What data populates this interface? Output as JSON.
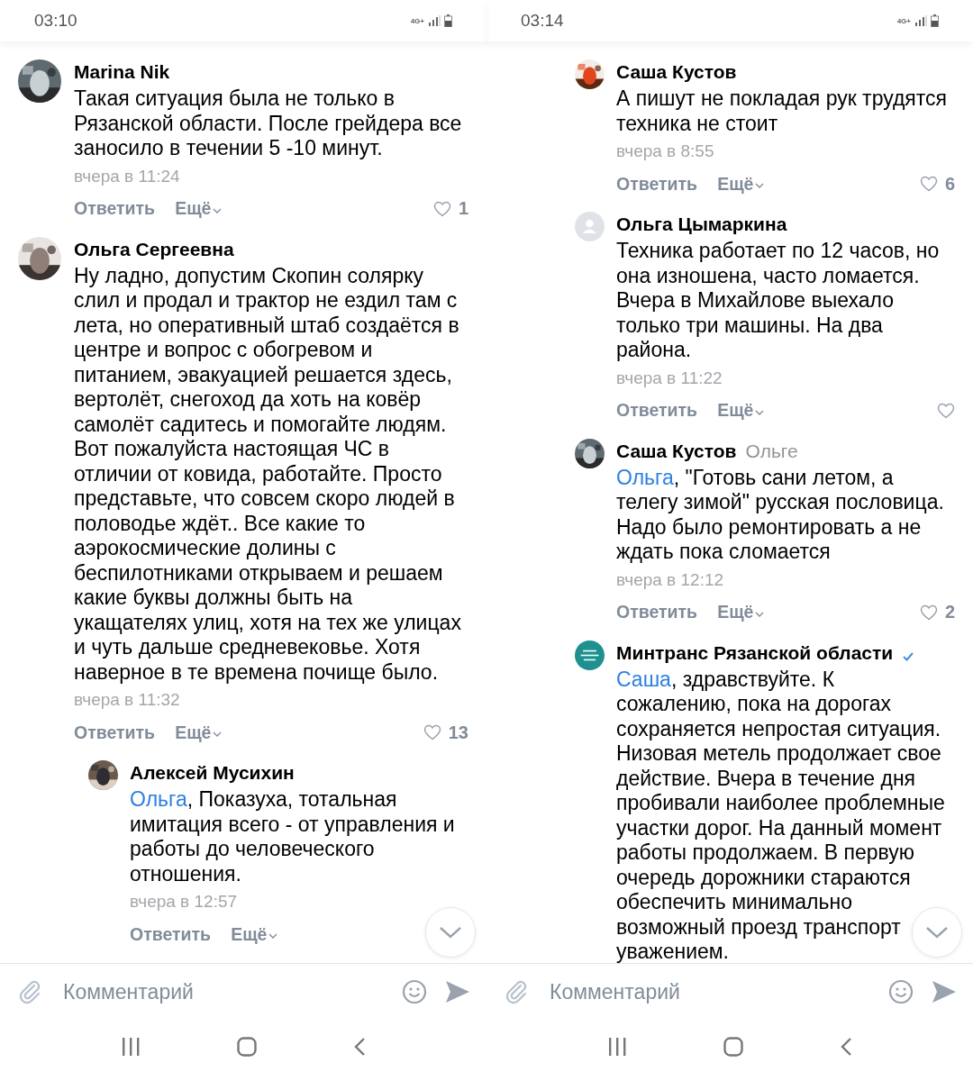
{
  "panels": [
    {
      "status_bar": {
        "time": "03:10",
        "network": "4G+"
      },
      "comments": [
        {
          "author": "Marina Nik",
          "body": "Такая ситуация была не только в Рязанской области. После грейдера все заносило в течении 5 -10 минут.",
          "time": "вчера в 11:24",
          "reply": "Ответить",
          "more": "Ещё",
          "like_button": true,
          "likes": "1"
        },
        {
          "author": "Ольга Сергеевна",
          "body": "Ну ладно, допустим Скопин солярку слил и продал и трактор не ездил там с лета, но оперативный штаб создаётся в центре и вопрос с обогревом и питанием, эвакуацией решается здесь, вертолёт, снегоход да хоть на ковёр самолёт садитесь и помогайте людям. Вот пожалуйста настоящая ЧС в отличии от ковида, работайте. Просто представьте, что совсем скоро людей в половодье ждёт.. Все какие то аэрокосмические долины с беспилотниками открываем и решаем какие буквы должны быть на укащателях улиц, хотя на тех же улицах и чуть дальше средневековье. Хотя наверное в те времена почище было.",
          "time": "вчера в 11:32",
          "reply": "Ответить",
          "more": "Ещё",
          "like_button": true,
          "likes": "13",
          "children": [
            {
              "author": "Алексей Мусихин",
              "mention": "Ольга",
              "body": ", Показуха, тотальная имитация всего - от управления и работы до человеческого отношения.",
              "time": "вчера в 12:57",
              "reply": "Ответить",
              "more": "Ещё"
            }
          ]
        }
      ],
      "composer": {
        "placeholder": "Комментарий"
      }
    },
    {
      "status_bar": {
        "time": "03:14",
        "network": "4G+"
      },
      "replies": [
        {
          "author": "Саша Кустов",
          "body": "А пишут не покладая рук трудятся техника не стоит",
          "time": "вчера в 8:55",
          "reply": "Ответить",
          "more": "Ещё",
          "like_button": true,
          "likes": "6"
        },
        {
          "author": "Ольга Цымаркина",
          "kind": "default",
          "body": "Техника работает по 12 часов, но она изношена, часто ломается. Вчера в Михайлове выехало только три машины. На два района.",
          "time": "вчера в 11:22",
          "reply": "Ответить",
          "more": "Ещё",
          "like_button": true
        },
        {
          "author": "Саша Кустов",
          "reply_to": "Ольге",
          "mention": "Ольга",
          "body": ", \"Готовь сани летом, а телегу зимой\" русская пословица. Надо было ремонтировать а не ждать пока сломается",
          "time": "вчера в 12:12",
          "reply": "Ответить",
          "more": "Ещё",
          "like_button": true,
          "likes": "2"
        },
        {
          "author": "Минтранс Рязанской области",
          "kind": "logo",
          "verified": true,
          "mention": "Саша",
          "body": ", здравствуйте. К сожалению, пока на дорогах сохраняется непростая ситуация. Низовая метель продолжает свое действие. Вчера в течение дня пробивали наиболее проблемные участки дорог. На данный момент работы продолжаем. В первую очередь дорожники стараются обеспечить минимально",
          "body_tail": "возможный проезд транспорт уважением."
        }
      ],
      "composer": {
        "placeholder": "Комментарий"
      }
    }
  ]
}
